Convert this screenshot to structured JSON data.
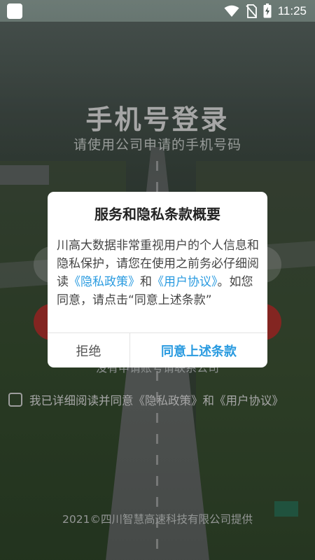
{
  "status_bar": {
    "time": "11:25",
    "icons": [
      "notification-square-icon",
      "wifi-icon",
      "no-sim-icon",
      "battery-charging-icon"
    ]
  },
  "login": {
    "title": "手机号登录",
    "subtitle": "请使用公司申请的手机号码",
    "hint": "没有申请账号请联系公司",
    "agreement": {
      "prefix": "我已详细阅读并同意",
      "privacy_link": "《隐私政策》",
      "and": "和",
      "user_link": "《用户协议》",
      "checked": false
    },
    "footer": "2021©四川智慧高速科技有限公司提供"
  },
  "dialog": {
    "title": "服务和隐私条款概要",
    "body_part1": "川高大数据非常重视用户的个人信息和隐私保护，请您在使用之前务必仔细阅读",
    "privacy_link": "《隐私政策》",
    "and": "和",
    "user_link": "《用户协议》",
    "body_part2": "。如您同意，请点击“同意上述条款”",
    "reject_label": "拒绝",
    "agree_label": "同意上述条款"
  },
  "colors": {
    "link": "#2a9be0",
    "login_button": "#c93a33",
    "dialog_bg": "#ffffff"
  }
}
